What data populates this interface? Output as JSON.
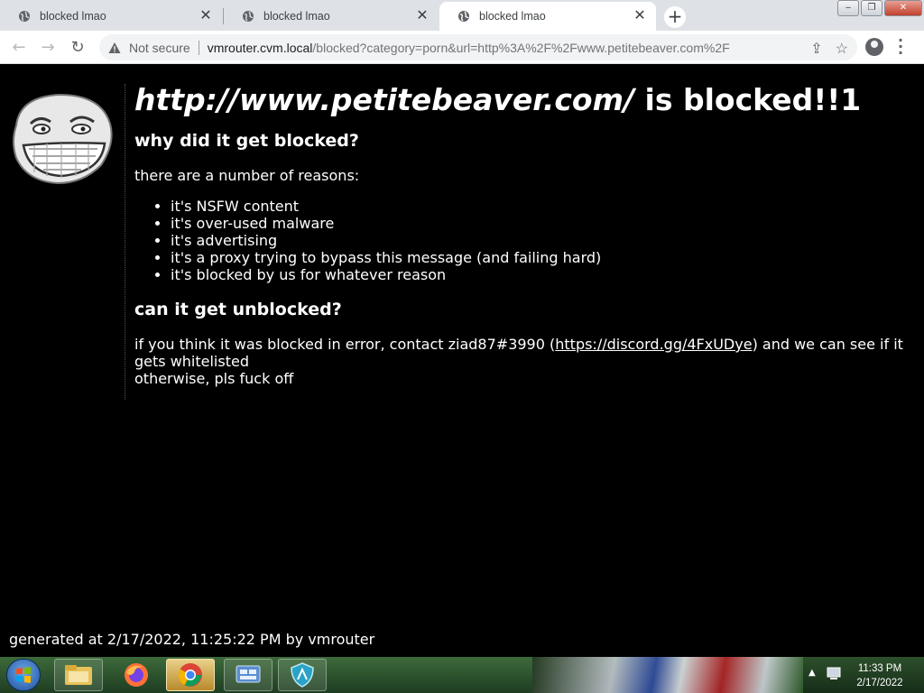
{
  "browser": {
    "tabs": [
      {
        "title": "blocked lmao",
        "active": false
      },
      {
        "title": "blocked lmao",
        "active": false
      },
      {
        "title": "blocked lmao",
        "active": true
      }
    ],
    "new_tab_label": "+",
    "close_glyph": "✕",
    "address": {
      "security_label": "Not secure",
      "host": "vmrouter.cvm.local",
      "path": "/blocked?category=porn&url=http%3A%2F%2Fwww.petitebeaver.com%2F"
    }
  },
  "page": {
    "blocked_url": "http://www.petitebeaver.com/",
    "blocked_suffix": " is blocked!!1",
    "why_heading": "why did it get blocked?",
    "reasons_intro": "there are a number of reasons:",
    "reasons": [
      "it's NSFW content",
      "it's over-used malware",
      "it's advertising",
      "it's a proxy trying to bypass this message (and failing hard)",
      "it's blocked by us for whatever reason"
    ],
    "unblock_heading": "can it get unblocked?",
    "unblock_text_before": "if you think it was blocked in error, contact ziad87#3990 (",
    "discord_link": "https://discord.gg/4FxUDye",
    "unblock_text_after": ") and we can see if it gets whitelisted",
    "dismissal": "otherwise, pls fuck off",
    "footer": "generated at 2/17/2022, 11:25:22 PM by vmrouter"
  },
  "taskbar": {
    "apps": [
      "file-explorer",
      "firefox",
      "chrome",
      "control-panel",
      "shield-app"
    ],
    "clock_time": "11:33 PM",
    "clock_date": "2/17/2022"
  },
  "colors": {
    "page_bg": "#000000",
    "text": "#ffffff",
    "tabstrip_bg": "#dee1e6",
    "omnibox_bg": "#f1f3f4"
  }
}
